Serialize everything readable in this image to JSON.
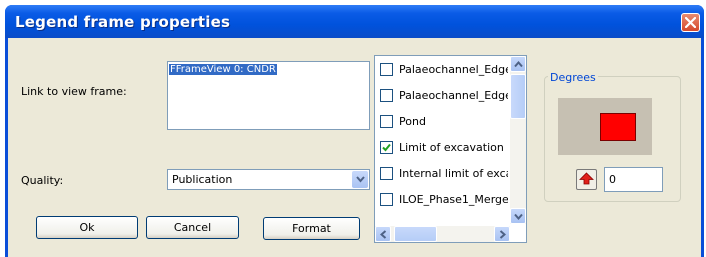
{
  "window": {
    "title": "Legend frame properties",
    "close_icon": "close-icon"
  },
  "link": {
    "label": "Link to view frame:",
    "items": [
      "FFrameView 0: CNDR"
    ]
  },
  "quality": {
    "label": "Quality:",
    "selected": "Publication"
  },
  "buttons": {
    "ok": "Ok",
    "cancel": "Cancel",
    "format": "Format"
  },
  "layers": [
    {
      "label": "Palaeochannel_Edge",
      "checked": false
    },
    {
      "label": "Palaeochannel_Edge",
      "checked": false
    },
    {
      "label": "Pond",
      "checked": false
    },
    {
      "label": "Limit of excavation",
      "checked": true
    },
    {
      "label": "Internal limit of exca",
      "checked": false
    },
    {
      "label": "ILOE_Phase1_Merge",
      "checked": false
    }
  ],
  "degrees": {
    "caption": "Degrees",
    "value": "0",
    "preview_color": "#ff0000"
  }
}
